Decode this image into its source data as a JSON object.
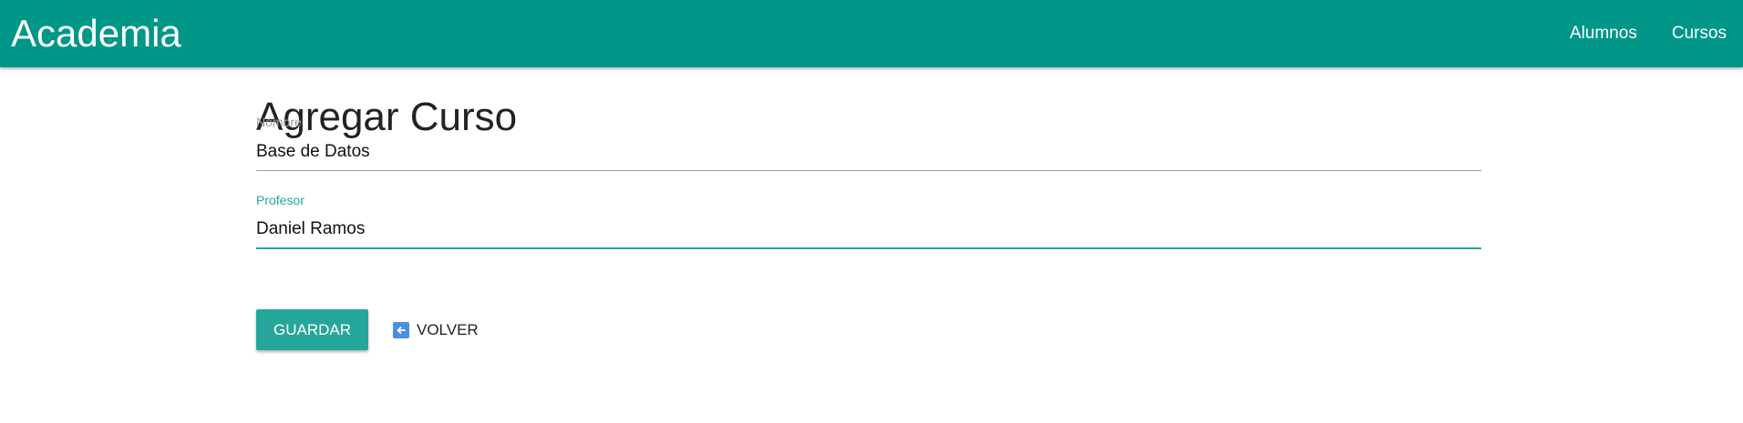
{
  "navbar": {
    "brand": "Academia",
    "links": [
      {
        "label": "Alumnos"
      },
      {
        "label": "Cursos"
      }
    ],
    "color": "#009688"
  },
  "page": {
    "title": "Agregar Curso"
  },
  "form": {
    "nombre": {
      "label": "Nombre",
      "value": "Base de Datos"
    },
    "profesor": {
      "label": "Profesor",
      "value": "Daniel Ramos"
    }
  },
  "actions": {
    "save_label": "GUARDAR",
    "back_label": "VOLVER",
    "back_icon": "arrow-left-icon",
    "accent": "#26a69a"
  }
}
